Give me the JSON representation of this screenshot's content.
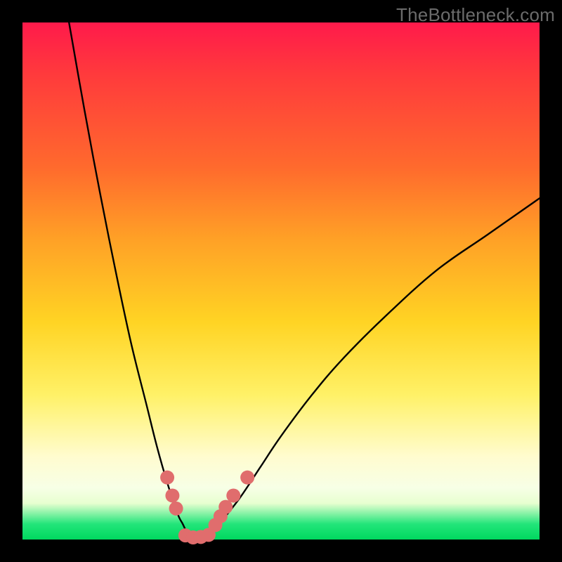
{
  "watermark": "TheBottleneck.com",
  "chart_data": {
    "type": "line",
    "title": "",
    "xlabel": "",
    "ylabel": "",
    "xlim": [
      0,
      100
    ],
    "ylim": [
      0,
      100
    ],
    "series": [
      {
        "name": "bottleneck-curve",
        "x": [
          9,
          12,
          15,
          18,
          21,
          24,
          26,
          28,
          30,
          31,
          32,
          33,
          34,
          35,
          36,
          38,
          42,
          46,
          50,
          56,
          62,
          70,
          80,
          90,
          100
        ],
        "y": [
          100,
          83,
          67,
          52,
          38,
          26,
          18,
          11,
          5,
          3,
          1,
          0,
          0,
          0,
          1,
          3,
          8,
          14,
          20,
          28,
          35,
          43,
          52,
          59,
          66
        ]
      }
    ],
    "markers": [
      {
        "name": "left-marker-1",
        "x": 28.0,
        "y": 12.0
      },
      {
        "name": "left-marker-2",
        "x": 29.0,
        "y": 8.5
      },
      {
        "name": "left-marker-3",
        "x": 29.7,
        "y": 6.0
      },
      {
        "name": "flat-marker-1",
        "x": 31.5,
        "y": 0.8
      },
      {
        "name": "flat-marker-2",
        "x": 33.0,
        "y": 0.4
      },
      {
        "name": "flat-marker-3",
        "x": 34.5,
        "y": 0.5
      },
      {
        "name": "flat-marker-4",
        "x": 36.0,
        "y": 0.9
      },
      {
        "name": "right-marker-1",
        "x": 37.3,
        "y": 2.8
      },
      {
        "name": "right-marker-2",
        "x": 38.3,
        "y": 4.5
      },
      {
        "name": "right-marker-3",
        "x": 39.3,
        "y": 6.3
      },
      {
        "name": "right-marker-4",
        "x": 40.8,
        "y": 8.5
      },
      {
        "name": "right-marker-5",
        "x": 43.5,
        "y": 12.0
      }
    ],
    "marker_radius_px": 10,
    "marker_color": "#e06d6d",
    "curve_color": "#000000"
  }
}
